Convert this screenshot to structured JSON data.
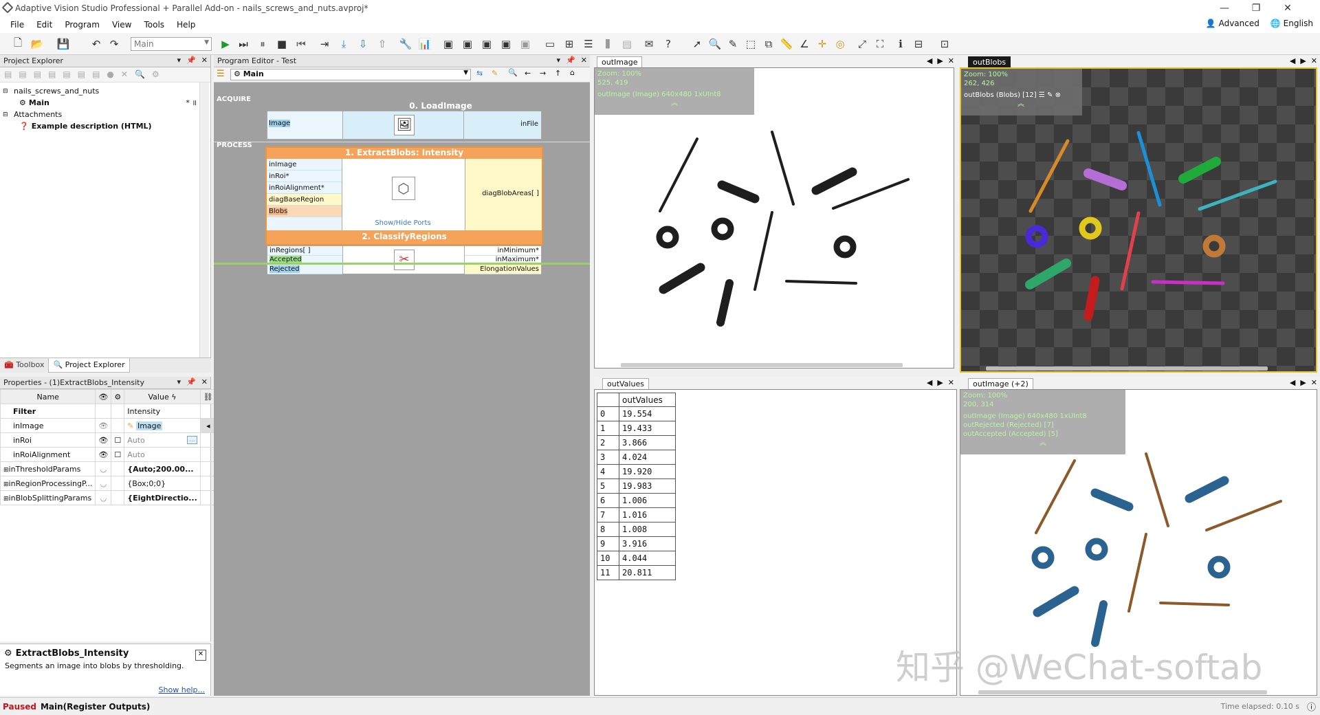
{
  "window": {
    "title": "Adaptive Vision Studio Professional + Parallel Add-on - nails_screws_and_nuts.avproj*"
  },
  "menu": {
    "items": [
      "File",
      "Edit",
      "Program",
      "View",
      "Tools",
      "Help"
    ],
    "advanced": "Advanced",
    "language": "English"
  },
  "toolbar": {
    "program_select": "Main"
  },
  "project_explorer": {
    "title": "Project Explorer",
    "items": {
      "project": "nails_screws_and_nuts",
      "main": "Main",
      "main_flags": "* ॥",
      "attachments": "Attachments",
      "example": "Example description (HTML)"
    },
    "bottom_tabs": {
      "toolbox": "Toolbox",
      "explorer": "Project Explorer"
    }
  },
  "properties": {
    "title": "Properties - (1)ExtractBlobs_Intensity",
    "col_name": "Name",
    "col_value": "Value",
    "rows": [
      {
        "name": "Filter",
        "value": "Intensity"
      },
      {
        "name": "inImage",
        "value": "Image"
      },
      {
        "name": "inRoi",
        "value": "Auto"
      },
      {
        "name": "inRoiAlignment",
        "value": "Auto"
      },
      {
        "name": "inThresholdParams",
        "value": "{Auto;200.00..."
      },
      {
        "name": "inRegionProcessingP...",
        "value": "{Box;0;0}"
      },
      {
        "name": "inBlobSplittingParams",
        "value": "{EightDirectio..."
      }
    ]
  },
  "help": {
    "title": "ExtractBlobs_Intensity",
    "desc": "Segments an image into blobs by thresholding.",
    "link": "Show help..."
  },
  "program_editor": {
    "title": "Program Editor - Test",
    "nav": "Main",
    "sections": {
      "acquire": "ACQUIRE",
      "process": "PROCESS"
    },
    "blocks": {
      "load": {
        "title": "0. LoadImage",
        "in": "Image",
        "out": "inFile"
      },
      "extract": {
        "title": "1. ExtractBlobs: Intensity",
        "ports": [
          "inImage",
          "inRoi*",
          "inRoiAlignment*",
          "diagBaseRegion",
          "Blobs"
        ],
        "toggle": "Show/Hide Ports",
        "out": "diagBlobAreas[ ]"
      },
      "classify": {
        "title": "2. ClassifyRegions",
        "ports": [
          "inRegions[ ]",
          "Accepted",
          "Rejected"
        ],
        "outs": [
          "inMinimum*",
          "inMaximum*",
          "ElongationValues"
        ]
      }
    }
  },
  "views": {
    "outImage": {
      "tab": "outImage",
      "zoom": "Zoom: 100%",
      "coords": "525, 419",
      "label": "outImage (Image) 640x480 1xUInt8"
    },
    "outBlobs": {
      "tab": "outBlobs",
      "zoom": "Zoom: 100%",
      "coords": "262, 426",
      "label": "outBlobs (Blobs) [12]"
    },
    "outValues": {
      "tab": "outValues",
      "header": "outValues",
      "rows": [
        [
          "0",
          "19.554"
        ],
        [
          "1",
          "19.433"
        ],
        [
          "2",
          "3.866"
        ],
        [
          "3",
          "4.024"
        ],
        [
          "4",
          "19.920"
        ],
        [
          "5",
          "19.983"
        ],
        [
          "6",
          "1.006"
        ],
        [
          "7",
          "1.016"
        ],
        [
          "8",
          "1.008"
        ],
        [
          "9",
          "3.916"
        ],
        [
          "10",
          "4.044"
        ],
        [
          "11",
          "20.811"
        ]
      ]
    },
    "outImage2": {
      "tab": "outImage (+2)",
      "zoom": "Zoom: 100%",
      "coords": "200, 314",
      "label1": "outImage (Image) 640x480 1xUInt8",
      "label2": "outRejected (Rejected) [7]",
      "label3": "outAccepted (Accepted) [5]"
    }
  },
  "watermark": "知乎 @WeChat-softab",
  "status": {
    "state": "Paused",
    "detail": "Main(Register Outputs)",
    "elapsed": "Time elapsed: 0.10 s"
  }
}
